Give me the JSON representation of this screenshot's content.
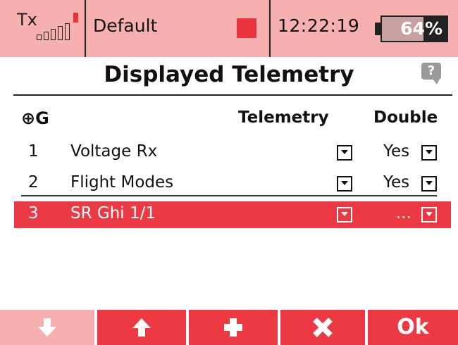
{
  "status": {
    "tx_label": "Tx",
    "model_name": "Default",
    "time": "12:22:19",
    "battery_percent": 64,
    "battery_label": "64%"
  },
  "page": {
    "title": "Displayed Telemetry",
    "help_label": "?"
  },
  "table": {
    "header_globe": "⊕G",
    "header_telemetry": "Telemetry",
    "header_double": "Double",
    "rows": [
      {
        "num": "1",
        "name": "Voltage Rx",
        "double": "Yes"
      },
      {
        "num": "2",
        "name": "Flight Modes",
        "double": "Yes"
      },
      {
        "num": "3",
        "name": "SR Ghi 1/1",
        "double": "..."
      }
    ]
  },
  "toolbar": {
    "buttons": [
      {
        "icon": "arrow-down-icon",
        "enabled": false
      },
      {
        "icon": "arrow-up-icon",
        "enabled": true
      },
      {
        "icon": "plus-icon",
        "enabled": true
      },
      {
        "icon": "close-icon",
        "enabled": true
      },
      {
        "label": "Ok",
        "enabled": true
      }
    ]
  },
  "colors": {
    "accent": "#ec3a44",
    "status_bar": "#f6b0b0",
    "disabled": "#f6b0b0"
  }
}
